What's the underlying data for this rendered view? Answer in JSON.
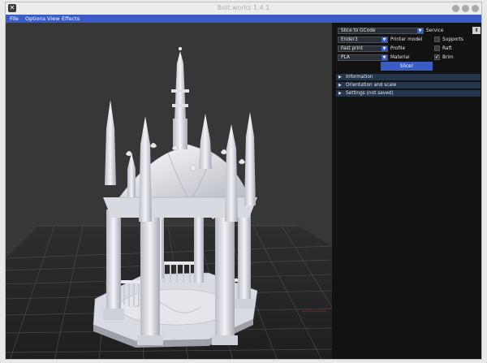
{
  "window": {
    "title": "Bolt.works 1.4.1"
  },
  "menu": [
    "File",
    "Options",
    "View",
    "Effects"
  ],
  "panel": {
    "mode": {
      "value": "Slice to GCode",
      "label": "Service"
    },
    "printer": {
      "value": "Ender3",
      "label": "Printer model"
    },
    "profile": {
      "value": "Fast print",
      "label": "Profile"
    },
    "material": {
      "value": "PLA",
      "label": "Material"
    },
    "options": [
      {
        "label": "Supports",
        "checked": false,
        "mark": ""
      },
      {
        "label": "Raft",
        "checked": false,
        "mark": ""
      },
      {
        "label": "Brim",
        "checked": true,
        "mark": "✓"
      }
    ],
    "slice_button": "Slice!",
    "sections": [
      {
        "label": "Information",
        "arrow": "▶"
      },
      {
        "label": "Orientation and scale",
        "arrow": "▶"
      },
      {
        "label": "Settings (not saved)",
        "arrow": "▶"
      }
    ]
  },
  "colors": {
    "accent": "#3a5cc4",
    "panel": "#121212",
    "viewport": "#373737",
    "section": "#24354e"
  }
}
